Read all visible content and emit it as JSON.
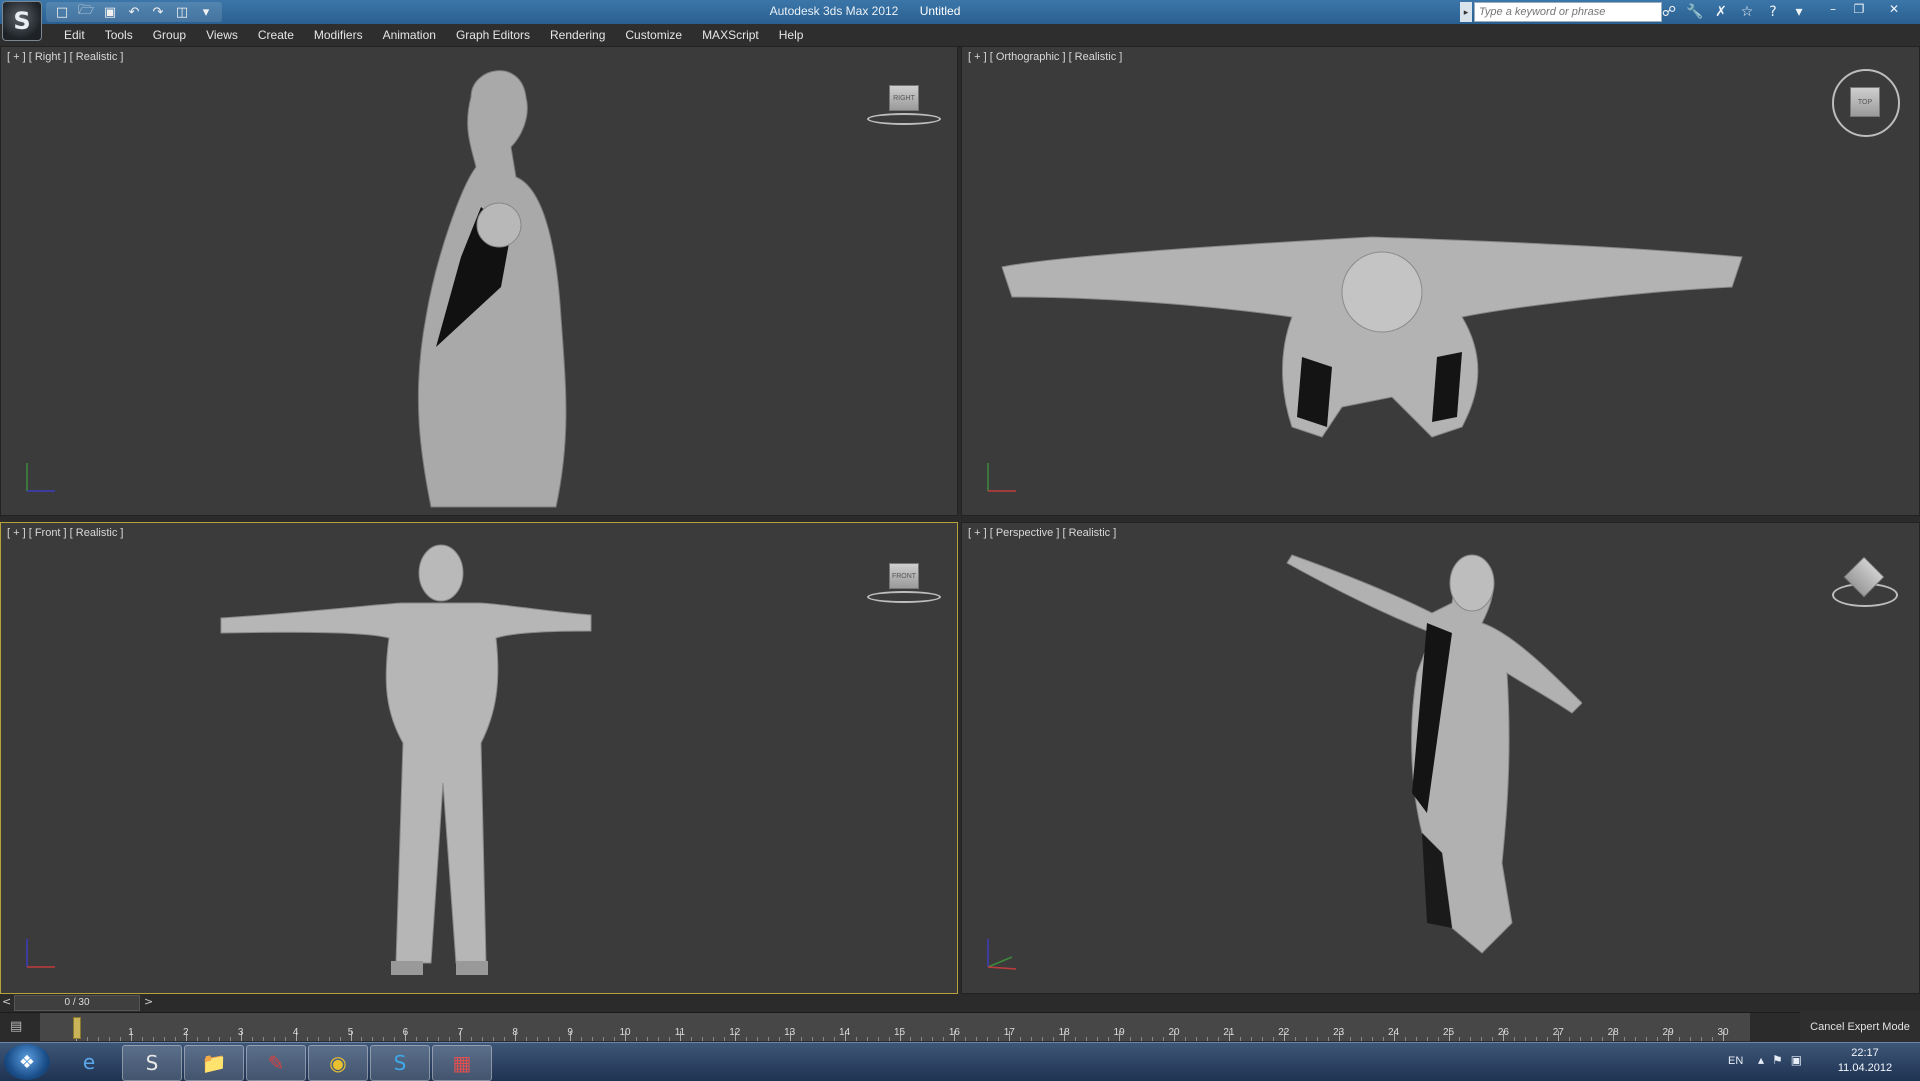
{
  "titlebar": {
    "app_title": "Autodesk 3ds Max  2012",
    "document": "Untitled",
    "search_placeholder": "Type a keyword or phrase"
  },
  "quick_access": {
    "icons": [
      "new-file-icon",
      "open-file-icon",
      "save-icon",
      "undo-icon",
      "redo-icon",
      "project-folder-icon",
      "dropdown-icon"
    ]
  },
  "menu": {
    "items": [
      "Edit",
      "Tools",
      "Group",
      "Views",
      "Create",
      "Modifiers",
      "Animation",
      "Graph Editors",
      "Rendering",
      "Customize",
      "MAXScript",
      "Help"
    ]
  },
  "viewports": {
    "right": {
      "label": "[ + ] [ Right ] [ Realistic ]",
      "cube": "RIGHT"
    },
    "top": {
      "label": "[ + ] [ Orthographic ] [ Realistic ]",
      "cube": "TOP"
    },
    "front": {
      "label": "[ + ] [ Front ] [ Realistic ]",
      "cube": "FRONT"
    },
    "perspective": {
      "label": "[ + ] [ Perspective ] [ Realistic ]",
      "cube": ""
    }
  },
  "timeline": {
    "counter": "0 / 30",
    "prev": "<",
    "next": ">",
    "ticks": [
      "0",
      "1",
      "2",
      "3",
      "4",
      "5",
      "6",
      "7",
      "8",
      "9",
      "10",
      "11",
      "12",
      "13",
      "14",
      "15",
      "16",
      "17",
      "18",
      "19",
      "20",
      "21",
      "22",
      "23",
      "24",
      "25",
      "26",
      "27",
      "28",
      "29",
      "30"
    ],
    "current_frame": 0,
    "total_frames": 30
  },
  "status": {
    "cancel_expert": "Cancel Expert Mode"
  },
  "taskbar": {
    "apps": [
      "ie-icon",
      "3dsmax-icon",
      "explorer-icon",
      "paint-icon",
      "chrome-icon",
      "skype-icon",
      "viewer-icon"
    ],
    "lang": "EN",
    "time": "22:17",
    "date": "11.04.2012"
  },
  "colors": {
    "active_border": "#b8a13b",
    "viewport_bg": "#3b3b3b",
    "titlebar": "#2f6698"
  }
}
